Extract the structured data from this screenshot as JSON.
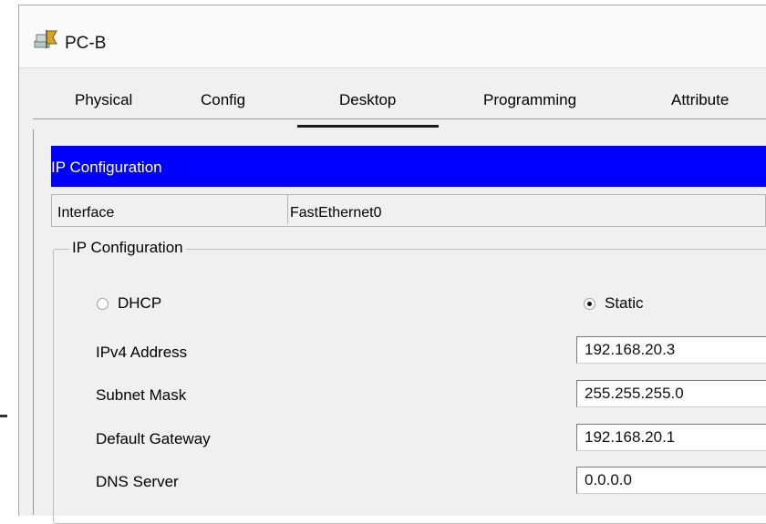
{
  "window": {
    "title": "PC-B",
    "icon": "pc-icon"
  },
  "tabs": [
    {
      "label": "Physical"
    },
    {
      "label": "Config"
    },
    {
      "label": "Desktop",
      "selected": true
    },
    {
      "label": "Programming"
    },
    {
      "label": "Attribute"
    }
  ],
  "header": {
    "title": "IP Configuration",
    "color": "#0000ff"
  },
  "interface": {
    "label": "Interface",
    "value": "FastEthernet0"
  },
  "ip_config": {
    "legend": "IP Configuration",
    "dhcp_label": "DHCP",
    "static_label": "Static",
    "selected_mode": "Static",
    "fields": {
      "ipv4": {
        "label": "IPv4 Address",
        "value": "192.168.20.3"
      },
      "subnet": {
        "label": "Subnet Mask",
        "value": "255.255.255.0"
      },
      "gateway": {
        "label": "Default Gateway",
        "value": "192.168.20.1"
      },
      "dns": {
        "label": "DNS Server",
        "value": "0.0.0.0"
      }
    }
  }
}
